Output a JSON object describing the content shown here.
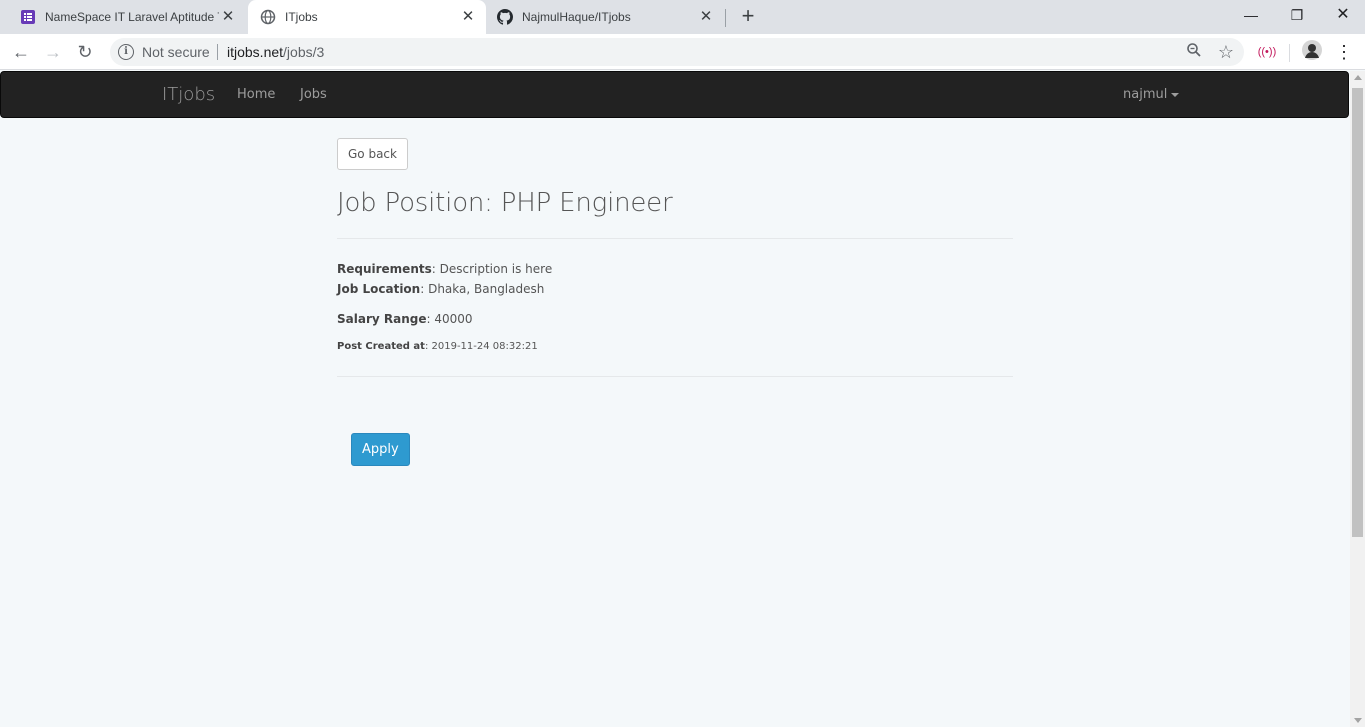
{
  "browser": {
    "tabs": [
      {
        "title": "NameSpace IT Laravel Aptitude T",
        "active": false,
        "icon": "forms-icon"
      },
      {
        "title": "ITjobs",
        "active": true,
        "icon": "globe-icon"
      },
      {
        "title": "NajmulHaque/ITjobs",
        "active": false,
        "icon": "github-icon"
      }
    ],
    "address_bar": {
      "security_label": "Not secure",
      "url_host": "itjobs.net",
      "url_path": "/jobs/3"
    }
  },
  "navbar": {
    "brand": "ITjobs",
    "links": [
      "Home",
      "Jobs"
    ],
    "user": "najmul"
  },
  "job": {
    "back_label": "Go back",
    "title": "Job Position: PHP Engineer",
    "requirements_label": "Requirements",
    "requirements_value": ": Description is here",
    "location_label": "Job Location",
    "location_value": ": Dhaka, Bangladesh",
    "salary_label": "Salary Range",
    "salary_value": ": 40000",
    "created_label": "Post Created at",
    "created_value": ": 2019-11-24 08:32:21",
    "apply_label": "Apply"
  },
  "colors": {
    "navbar_bg": "#222222",
    "page_bg": "#f4f8fa",
    "apply_bg": "#2e9ad0"
  }
}
